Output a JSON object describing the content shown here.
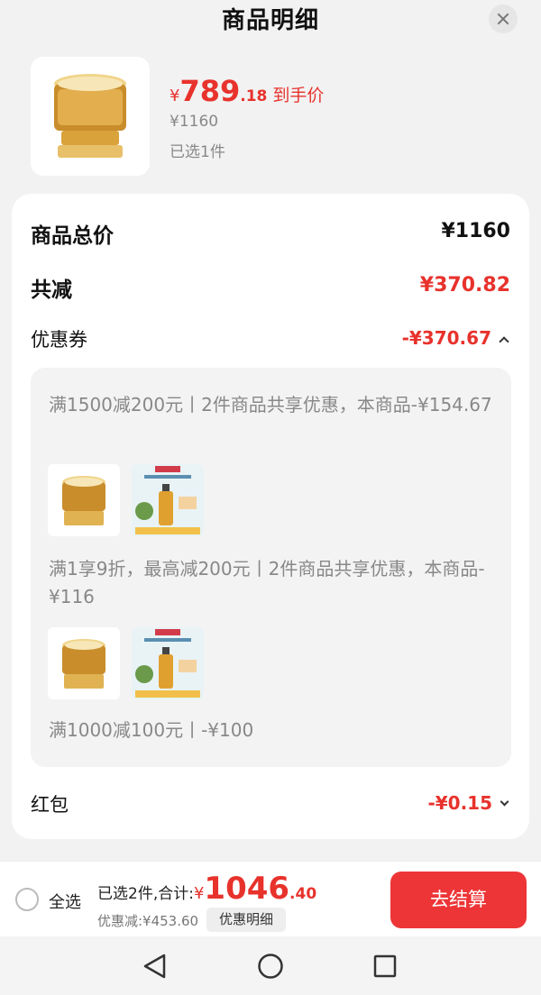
{
  "header": {
    "title": "商品明细"
  },
  "product": {
    "price_currency": "¥",
    "price_int": "789",
    "price_dec": ".18",
    "price_tag": "到手价",
    "original_price": "¥1160",
    "selected": "已选1件"
  },
  "summary": {
    "total_label": "商品总价",
    "total_value": "¥1160",
    "reduce_label": "共减",
    "reduce_value": "¥370.82",
    "coupon_label": "优惠券",
    "coupon_value": "-¥370.67",
    "redpacket_label": "红包",
    "redpacket_value": "-¥0.15"
  },
  "coupons": [
    {
      "text": "满1500减200元丨2件商品共享优惠，本商品-¥154.67"
    },
    {
      "text": "满1享9折，最高减200元丨2件商品共享优惠，本商品-¥116"
    },
    {
      "text": "满1000减100元丨-¥100"
    }
  ],
  "bottom": {
    "select_all": "全选",
    "sum_label": "已选2件,合计:",
    "sum_currency": "¥",
    "sum_int": "1046",
    "sum_dec": ".40",
    "discount": "优惠减:¥453.60",
    "detail_button": "优惠明细",
    "checkout_button": "去结算"
  },
  "colors": {
    "accent_red": "#e8322c",
    "checkout_red": "#ed3537"
  },
  "icons": [
    "close-icon",
    "chevron-up-icon",
    "chevron-down-icon",
    "nav-back-icon",
    "nav-home-icon",
    "nav-recent-icon"
  ]
}
